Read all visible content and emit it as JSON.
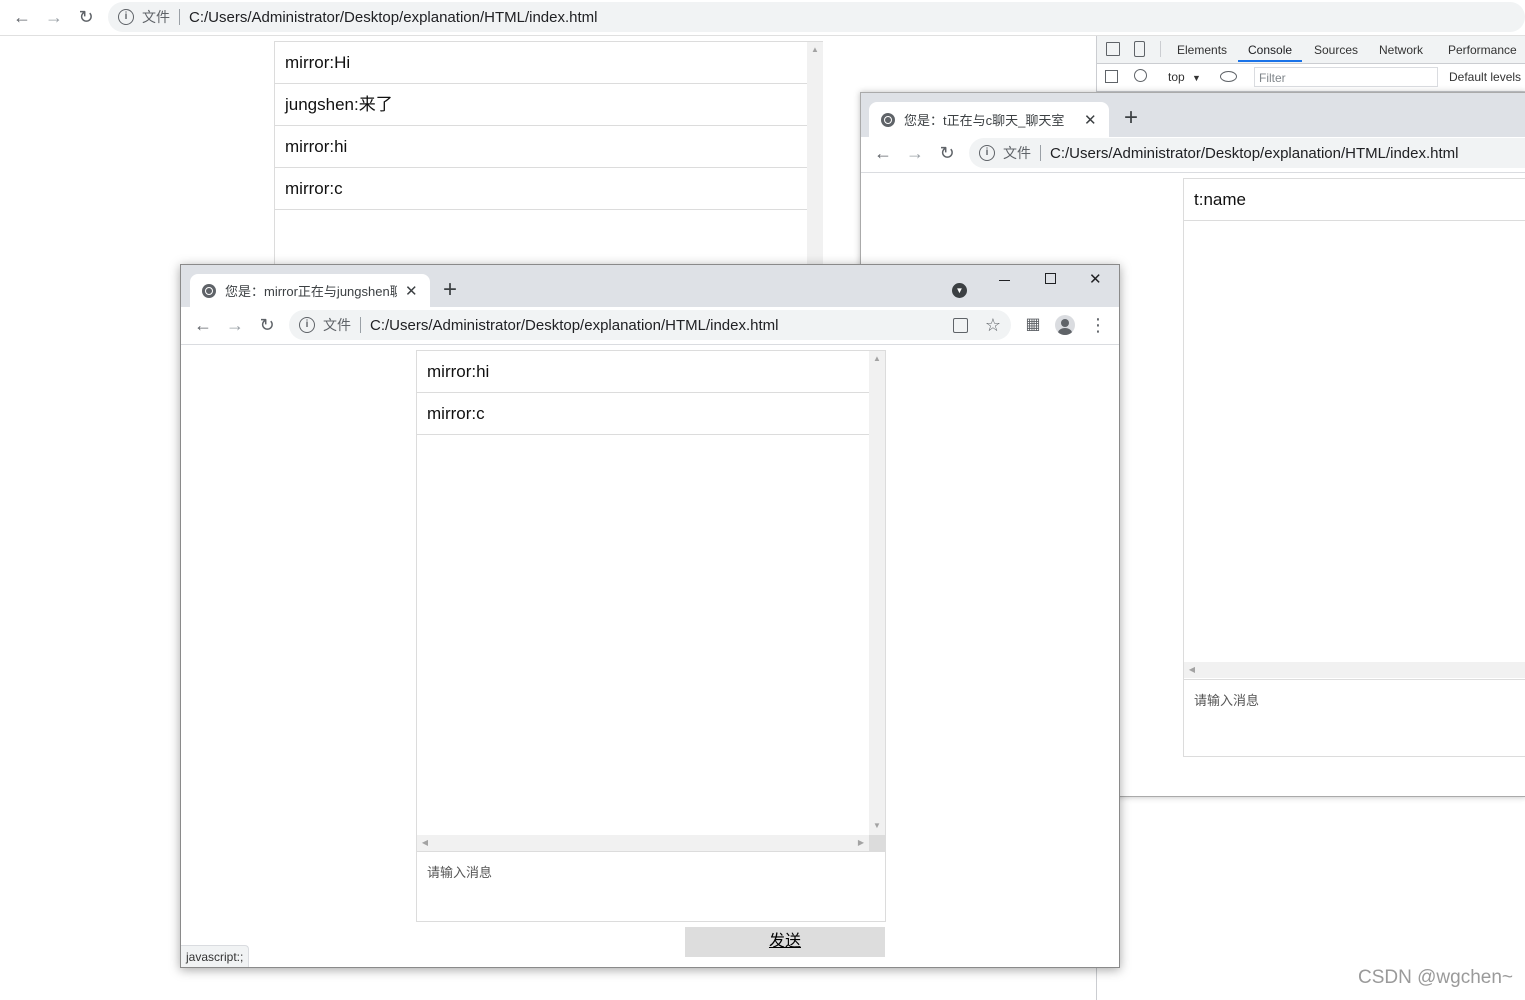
{
  "background_window": {
    "address": {
      "file_label": "文件",
      "url": "C:/Users/Administrator/Desktop/explanation/HTML/index.html"
    },
    "messages": [
      "mirror:Hi",
      "jungshen:来了",
      "mirror:hi",
      "mirror:c"
    ],
    "devtools": {
      "tabs": [
        "Elements",
        "Console",
        "Sources",
        "Network",
        "Performance"
      ],
      "active_tab": "Console",
      "context": "top",
      "filter_placeholder": "Filter",
      "levels": "Default levels"
    }
  },
  "middle_window": {
    "tab_title": "您是：t正在与c聊天_聊天室",
    "address": {
      "file_label": "文件",
      "url": "C:/Users/Administrator/Desktop/explanation/HTML/index.html"
    },
    "messages": [
      "t:name"
    ],
    "input_placeholder": "请输入消息"
  },
  "front_window": {
    "tab_title": "您是：mirror正在与jungshen聊天_聊天室",
    "address": {
      "file_label": "文件",
      "url": "C:/Users/Administrator/Desktop/explanation/HTML/index.html"
    },
    "messages": [
      "mirror:hi",
      "mirror:c"
    ],
    "input_placeholder": "请输入消息",
    "send_label": "发送",
    "status_bar": "javascript:;"
  },
  "watermark": "CSDN @wgchen~",
  "colors": {
    "tab_strip": "#dee1e6",
    "omnibox": "#f1f3f4",
    "devtools_accent": "#1a73e8",
    "send_button": "#dddddd"
  }
}
